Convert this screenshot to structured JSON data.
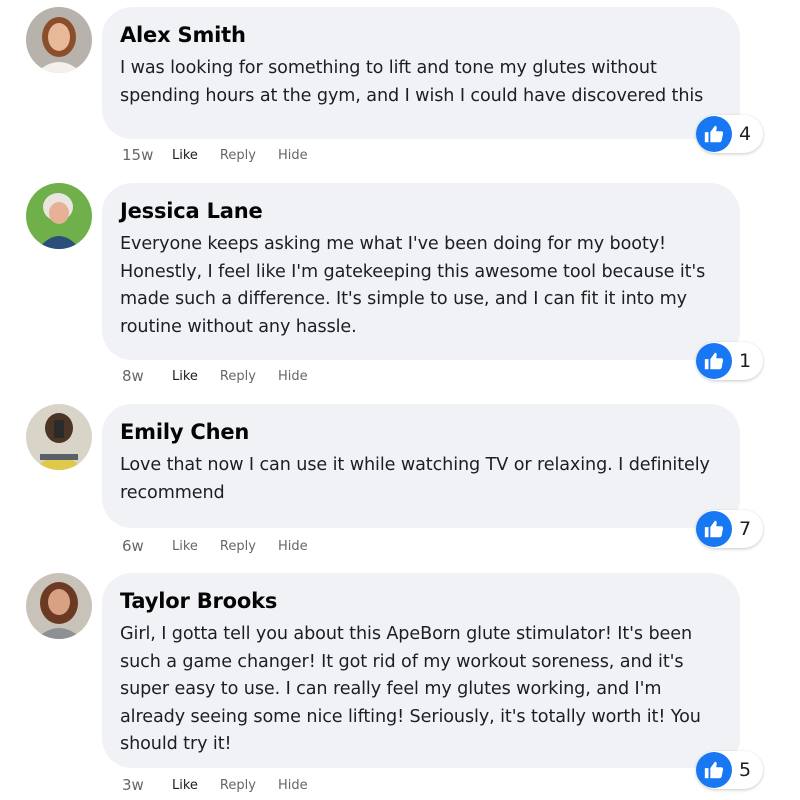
{
  "accent_color": "#1877f2",
  "bubble_color": "#f0f2f5",
  "comments": [
    {
      "author": "Alex Smith",
      "text": "I was looking for something to lift and tone my glutes without spending hours at the gym, and I wish I could have discovered this",
      "time": "15w",
      "like_label": "Like",
      "reply_label": "Reply",
      "hide_label": "Hide",
      "reaction_icon": "thumbs-up-icon",
      "reaction_count": "4"
    },
    {
      "author": "Jessica Lane",
      "text": "Everyone keeps asking me what I've been doing for my booty! Honestly, I feel like I'm gatekeeping this awesome tool because it's made such a difference. It's simple to use, and I can fit it into my routine without any hassle.",
      "time": "8w",
      "like_label": "Like",
      "reply_label": "Reply",
      "hide_label": "Hide",
      "reaction_icon": "thumbs-up-icon",
      "reaction_count": "1"
    },
    {
      "author": "Emily Chen",
      "text": "Love that now I can use it while watching TV or relaxing. I definitely recommend",
      "time": "6w",
      "like_label": "Like",
      "reply_label": "Reply",
      "hide_label": "Hide",
      "reaction_icon": "thumbs-up-icon",
      "reaction_count": "7"
    },
    {
      "author": "Taylor Brooks",
      "text": "Girl, I gotta tell you about this ApeBorn glute stimulator! It's been such a game changer! It got rid of my workout soreness, and it's super easy to use. I can really feel my glutes working, and I'm already seeing some nice lifting! Seriously, it's totally worth it! You should try it!",
      "time": "3w",
      "like_label": "Like",
      "reply_label": "Reply",
      "hide_label": "Hide",
      "reaction_icon": "thumbs-up-icon",
      "reaction_count": "5"
    }
  ]
}
